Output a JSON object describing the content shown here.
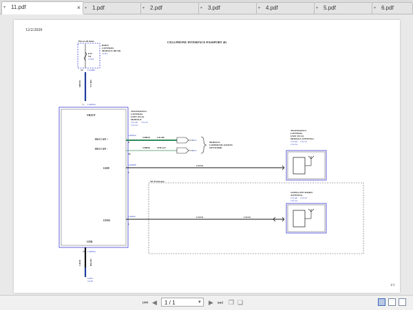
{
  "tabs": [
    {
      "label": "11.pdf",
      "active": true
    },
    {
      "label": "1.pdf",
      "active": false
    },
    {
      "label": "2.pdf",
      "active": false
    },
    {
      "label": "3.pdf",
      "active": false
    },
    {
      "label": "4.pdf",
      "active": false
    },
    {
      "label": "5.pdf",
      "active": false
    },
    {
      "label": "6.pdf",
      "active": false
    }
  ],
  "tab_close": "×",
  "doc": {
    "date": "12/2/2020",
    "title": "CELLPHONE INTERFACE PASSPORT 4G",
    "page_num": "1/1",
    "hot": "Hot at all times",
    "bcm": [
      "BODY",
      "CONTROL",
      "MODULE (BCM)"
    ],
    "bcm_ref": "11-63",
    "fuse": [
      "F33",
      "5A",
      "13-63"
    ],
    "conn_c2280c": "C2280C",
    "pin_16": "16",
    "wire_vbatt": [
      "SBP38",
      "VT-RD"
    ],
    "conn_c4803a": "C4803A",
    "pin_1": "1",
    "tcu": [
      "TELEMATICS",
      "CONTROL",
      "UNIT (TCU)",
      "MODULE"
    ],
    "tcu_refs": [
      "151-40",
      "151-52",
      "151-54"
    ],
    "vbatt": "VBATT",
    "hs3_plus": "HS3 CAN +",
    "hs3_minus": "HS3 CAN -",
    "gsm": "GSM",
    "gnss": "GNSS",
    "gnd": "GND",
    "c4803a_2": "C4803A",
    "pin_8": "8",
    "pin_16b": "16",
    "vdb29": "VDB29",
    "gn_bu": "GN-BU",
    "vdb30": "VDB30",
    "wh_gn": "WH-GN",
    "ref_149a": "14-9",
    "ref_149b": "14-9",
    "module_comm": [
      "MODULE",
      "COMMUNICATIONS",
      "NETWORK"
    ],
    "c4803b": "C4803B",
    "pin_1b": "1",
    "coax": "COAX",
    "tel_ant": [
      "TELEMATICS",
      "CONTROL",
      "UNIT (TCU)",
      "MODULE ANTENNA"
    ],
    "tel_ant_refs": [
      "151-40",
      "151-52",
      "151-54"
    ],
    "wifi": "Wi-Fi hotspot",
    "sat": [
      "SATELLITE RADIO",
      "ANTENNA"
    ],
    "sat_refs": [
      "151-40",
      "151-52",
      "151-54"
    ],
    "c4803c": "C4803C",
    "pin_1c": "1",
    "coax_2": "COAX",
    "coax_3": "COAX",
    "c4803a_3": "C4803A",
    "pin_13": "13",
    "wire_gnd": [
      "GD38",
      "BK-BU"
    ],
    "g303": "G303",
    "g303_ref": "10-20"
  },
  "colors": {
    "module_border": "#3b3bd6",
    "ref_blue": "#2a3fc8",
    "wire_blue": "#1a3a9a",
    "wire_green": "#2f8a56",
    "wire_black": "#111111"
  },
  "statusbar": {
    "first_icon": "first-page-icon",
    "prev_icon": "prev-page-icon",
    "page_value": "1 / 1",
    "next_icon": "next-page-icon",
    "last_icon": "last-page-icon"
  }
}
